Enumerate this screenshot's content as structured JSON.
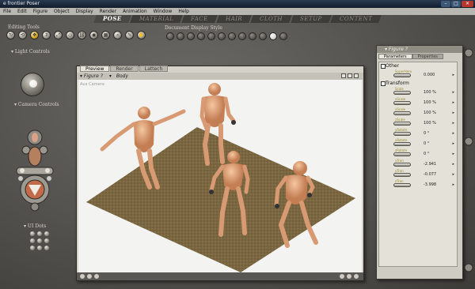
{
  "titlebar": {
    "title": "e frontier Poser"
  },
  "menu": [
    "File",
    "Edit",
    "Figure",
    "Object",
    "Display",
    "Render",
    "Animation",
    "Window",
    "Help"
  ],
  "rooms": [
    {
      "label": "POSE",
      "active": true
    },
    {
      "label": "MATERIAL",
      "active": false
    },
    {
      "label": "FACE",
      "active": false
    },
    {
      "label": "HAIR",
      "active": false
    },
    {
      "label": "CLOTH",
      "active": false
    },
    {
      "label": "SETUP",
      "active": false
    },
    {
      "label": "CONTENT",
      "active": false
    }
  ],
  "editing_tools": {
    "label": "Editing Tools"
  },
  "display_style": {
    "label": "Document Display Style"
  },
  "light_controls": {
    "label": "Light Controls"
  },
  "camera_controls": {
    "label": "Camera Controls"
  },
  "ik_dots": {
    "label": "UI Dots"
  },
  "document": {
    "tabs": [
      {
        "label": "Preview",
        "active": true
      },
      {
        "label": "Render",
        "active": false
      },
      {
        "label": "Lattech",
        "active": false
      }
    ],
    "figure_menu": "Figure ?",
    "body_menu": "Body",
    "camera_label": "Aux Camera"
  },
  "params_panel": {
    "title": "Figure ?",
    "tabs": [
      {
        "label": "Parameters",
        "active": true
      },
      {
        "label": "Properties",
        "active": false
      }
    ],
    "group_other": "Other",
    "group_transform": "Transform",
    "other_params": [
      {
        "name": "SuperHero",
        "value": "0.000"
      }
    ],
    "transform_params": [
      {
        "name": "Scale",
        "value": "100 %"
      },
      {
        "name": "xScale",
        "value": "100 %"
      },
      {
        "name": "yScale",
        "value": "100 %"
      },
      {
        "name": "zScale",
        "value": "100 %"
      },
      {
        "name": "yRotate",
        "value": "0 °"
      },
      {
        "name": "xRotate",
        "value": "0 °"
      },
      {
        "name": "zRotate",
        "value": "0 °"
      },
      {
        "name": "xTran",
        "value": "-2.941"
      },
      {
        "name": "yTran",
        "value": "-0.077"
      },
      {
        "name": "zTran",
        "value": "-3.998"
      }
    ]
  },
  "colors": {
    "skin": "#e6a378",
    "ground": "#7a6640",
    "accent": "#d5a524"
  }
}
